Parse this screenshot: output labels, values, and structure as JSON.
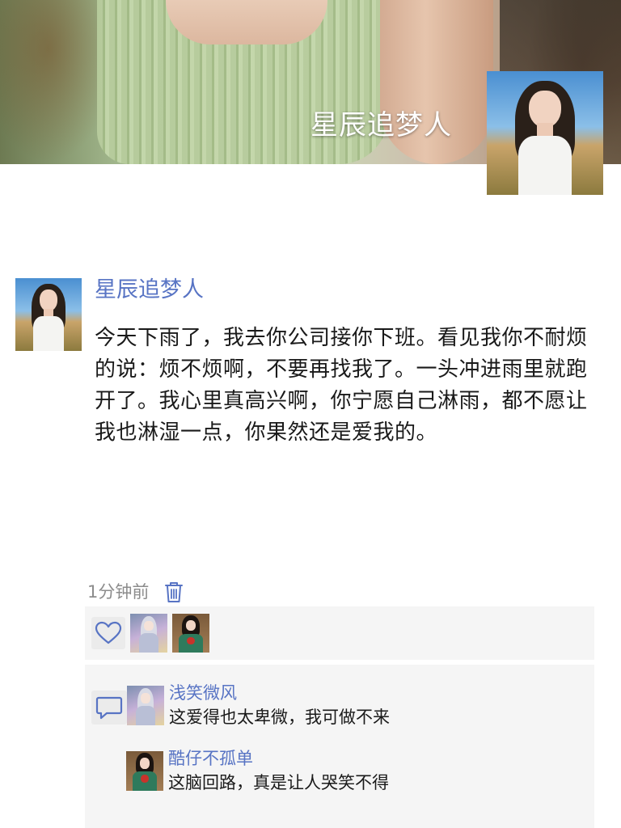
{
  "profile": {
    "cover_name": "星辰追梦人"
  },
  "post": {
    "author": "星辰追梦人",
    "content": "今天下雨了，我去你公司接你下班。看见我你不耐烦的说：烦不烦啊，不要再找我了。一头冲进雨里就跑开了。我心里真高兴啊，你宁愿自己淋雨，都不愿让我也淋湿一点，你果然还是爱我的。",
    "time": "1分钟前"
  },
  "likes": {
    "icon": "heart-outline-icon",
    "count_avatars": 2
  },
  "comments": [
    {
      "name": "浅笑微风",
      "text": "这爱得也太卑微，我可做不来"
    },
    {
      "name": "酷仔不孤单",
      "text": "这脑回路，真是让人哭笑不得"
    }
  ],
  "colors": {
    "name_link": "#5874c4",
    "text": "#1a1a1a",
    "muted": "#8c8c8c",
    "panel": "#f5f5f5"
  }
}
